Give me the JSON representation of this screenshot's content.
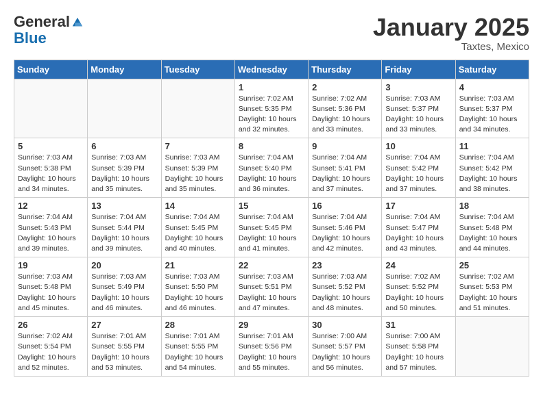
{
  "logo": {
    "general": "General",
    "blue": "Blue"
  },
  "title": "January 2025",
  "location": "Taxtes, Mexico",
  "days_of_week": [
    "Sunday",
    "Monday",
    "Tuesday",
    "Wednesday",
    "Thursday",
    "Friday",
    "Saturday"
  ],
  "weeks": [
    [
      {
        "num": "",
        "info": ""
      },
      {
        "num": "",
        "info": ""
      },
      {
        "num": "",
        "info": ""
      },
      {
        "num": "1",
        "info": "Sunrise: 7:02 AM\nSunset: 5:35 PM\nDaylight: 10 hours\nand 32 minutes."
      },
      {
        "num": "2",
        "info": "Sunrise: 7:02 AM\nSunset: 5:36 PM\nDaylight: 10 hours\nand 33 minutes."
      },
      {
        "num": "3",
        "info": "Sunrise: 7:03 AM\nSunset: 5:37 PM\nDaylight: 10 hours\nand 33 minutes."
      },
      {
        "num": "4",
        "info": "Sunrise: 7:03 AM\nSunset: 5:37 PM\nDaylight: 10 hours\nand 34 minutes."
      }
    ],
    [
      {
        "num": "5",
        "info": "Sunrise: 7:03 AM\nSunset: 5:38 PM\nDaylight: 10 hours\nand 34 minutes."
      },
      {
        "num": "6",
        "info": "Sunrise: 7:03 AM\nSunset: 5:39 PM\nDaylight: 10 hours\nand 35 minutes."
      },
      {
        "num": "7",
        "info": "Sunrise: 7:03 AM\nSunset: 5:39 PM\nDaylight: 10 hours\nand 35 minutes."
      },
      {
        "num": "8",
        "info": "Sunrise: 7:04 AM\nSunset: 5:40 PM\nDaylight: 10 hours\nand 36 minutes."
      },
      {
        "num": "9",
        "info": "Sunrise: 7:04 AM\nSunset: 5:41 PM\nDaylight: 10 hours\nand 37 minutes."
      },
      {
        "num": "10",
        "info": "Sunrise: 7:04 AM\nSunset: 5:42 PM\nDaylight: 10 hours\nand 37 minutes."
      },
      {
        "num": "11",
        "info": "Sunrise: 7:04 AM\nSunset: 5:42 PM\nDaylight: 10 hours\nand 38 minutes."
      }
    ],
    [
      {
        "num": "12",
        "info": "Sunrise: 7:04 AM\nSunset: 5:43 PM\nDaylight: 10 hours\nand 39 minutes."
      },
      {
        "num": "13",
        "info": "Sunrise: 7:04 AM\nSunset: 5:44 PM\nDaylight: 10 hours\nand 39 minutes."
      },
      {
        "num": "14",
        "info": "Sunrise: 7:04 AM\nSunset: 5:45 PM\nDaylight: 10 hours\nand 40 minutes."
      },
      {
        "num": "15",
        "info": "Sunrise: 7:04 AM\nSunset: 5:45 PM\nDaylight: 10 hours\nand 41 minutes."
      },
      {
        "num": "16",
        "info": "Sunrise: 7:04 AM\nSunset: 5:46 PM\nDaylight: 10 hours\nand 42 minutes."
      },
      {
        "num": "17",
        "info": "Sunrise: 7:04 AM\nSunset: 5:47 PM\nDaylight: 10 hours\nand 43 minutes."
      },
      {
        "num": "18",
        "info": "Sunrise: 7:04 AM\nSunset: 5:48 PM\nDaylight: 10 hours\nand 44 minutes."
      }
    ],
    [
      {
        "num": "19",
        "info": "Sunrise: 7:03 AM\nSunset: 5:48 PM\nDaylight: 10 hours\nand 45 minutes."
      },
      {
        "num": "20",
        "info": "Sunrise: 7:03 AM\nSunset: 5:49 PM\nDaylight: 10 hours\nand 46 minutes."
      },
      {
        "num": "21",
        "info": "Sunrise: 7:03 AM\nSunset: 5:50 PM\nDaylight: 10 hours\nand 46 minutes."
      },
      {
        "num": "22",
        "info": "Sunrise: 7:03 AM\nSunset: 5:51 PM\nDaylight: 10 hours\nand 47 minutes."
      },
      {
        "num": "23",
        "info": "Sunrise: 7:03 AM\nSunset: 5:52 PM\nDaylight: 10 hours\nand 48 minutes."
      },
      {
        "num": "24",
        "info": "Sunrise: 7:02 AM\nSunset: 5:52 PM\nDaylight: 10 hours\nand 50 minutes."
      },
      {
        "num": "25",
        "info": "Sunrise: 7:02 AM\nSunset: 5:53 PM\nDaylight: 10 hours\nand 51 minutes."
      }
    ],
    [
      {
        "num": "26",
        "info": "Sunrise: 7:02 AM\nSunset: 5:54 PM\nDaylight: 10 hours\nand 52 minutes."
      },
      {
        "num": "27",
        "info": "Sunrise: 7:01 AM\nSunset: 5:55 PM\nDaylight: 10 hours\nand 53 minutes."
      },
      {
        "num": "28",
        "info": "Sunrise: 7:01 AM\nSunset: 5:55 PM\nDaylight: 10 hours\nand 54 minutes."
      },
      {
        "num": "29",
        "info": "Sunrise: 7:01 AM\nSunset: 5:56 PM\nDaylight: 10 hours\nand 55 minutes."
      },
      {
        "num": "30",
        "info": "Sunrise: 7:00 AM\nSunset: 5:57 PM\nDaylight: 10 hours\nand 56 minutes."
      },
      {
        "num": "31",
        "info": "Sunrise: 7:00 AM\nSunset: 5:58 PM\nDaylight: 10 hours\nand 57 minutes."
      },
      {
        "num": "",
        "info": ""
      }
    ]
  ]
}
